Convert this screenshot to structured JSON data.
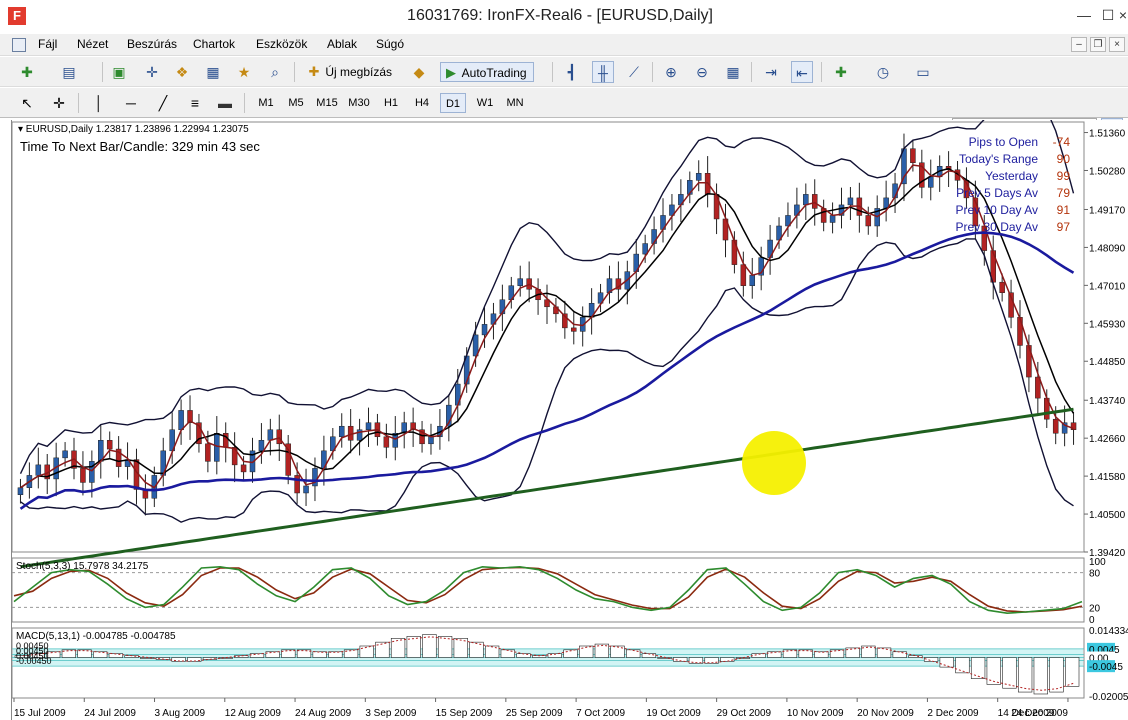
{
  "window": {
    "title": "16031769: IronFX-Real6 - [EURUSD,Daily]",
    "logo": "F",
    "controls": {
      "minimize": "—",
      "maximize": "☐",
      "close": "×"
    }
  },
  "menu": {
    "items": [
      "Fájl",
      "Nézet",
      "Beszúrás",
      "Chartok",
      "Eszközök",
      "Ablak",
      "Súgó"
    ],
    "mdi": {
      "minimize": "–",
      "restore": "❐",
      "close": "×"
    }
  },
  "toolbar": {
    "new_order_label": "Új megbízás",
    "autotrading_label": "AutoTrading",
    "search_placeholder": ""
  },
  "timeframes": [
    "M1",
    "M5",
    "M15",
    "M30",
    "H1",
    "H4",
    "D1",
    "W1",
    "MN"
  ],
  "active_timeframe": "D1",
  "chart_data": {
    "type": "candlestick",
    "symbol_header": "EURUSD,Daily  1.23817 1.23896 1.22994 1.23075",
    "bar_timer": "Time To Next Bar/Candle: 329 min 43 sec",
    "price_axis": [
      "1.51360",
      "1.50280",
      "1.49170",
      "1.48090",
      "1.47010",
      "1.45930",
      "1.44850",
      "1.43740",
      "1.42660",
      "1.41580",
      "1.40500",
      "1.39420"
    ],
    "ylim": [
      1.3942,
      1.5166
    ],
    "date_axis": [
      "15 Jul 2009",
      "24 Jul 2009",
      "3 Aug 2009",
      "12 Aug 2009",
      "24 Aug 2009",
      "3 Sep 2009",
      "15 Sep 2009",
      "25 Sep 2009",
      "7 Oct 2009",
      "19 Oct 2009",
      "29 Oct 2009",
      "10 Nov 2009",
      "20 Nov 2009",
      "2 Dec 2009",
      "14 Dec 2009",
      "24 Dec 2009"
    ],
    "closes": [
      1.4125,
      1.416,
      1.419,
      1.415,
      1.421,
      1.423,
      1.418,
      1.414,
      1.42,
      1.426,
      1.4235,
      1.4185,
      1.4205,
      1.412,
      1.4095,
      1.416,
      1.423,
      1.429,
      1.4345,
      1.431,
      1.425,
      1.42,
      1.428,
      1.424,
      1.419,
      1.417,
      1.423,
      1.426,
      1.429,
      1.425,
      1.416,
      1.411,
      1.413,
      1.418,
      1.423,
      1.427,
      1.43,
      1.426,
      1.429,
      1.431,
      1.427,
      1.424,
      1.428,
      1.431,
      1.429,
      1.425,
      1.427,
      1.43,
      1.436,
      1.442,
      1.45,
      1.456,
      1.459,
      1.462,
      1.466,
      1.47,
      1.472,
      1.469,
      1.466,
      1.464,
      1.462,
      1.458,
      1.457,
      1.461,
      1.465,
      1.468,
      1.472,
      1.469,
      1.474,
      1.479,
      1.482,
      1.486,
      1.49,
      1.493,
      1.496,
      1.5,
      1.502,
      1.496,
      1.489,
      1.483,
      1.476,
      1.47,
      1.473,
      1.478,
      1.483,
      1.487,
      1.49,
      1.493,
      1.496,
      1.492,
      1.488,
      1.49,
      1.493,
      1.495,
      1.49,
      1.487,
      1.492,
      1.495,
      1.499,
      1.509,
      1.505,
      1.498,
      1.501,
      1.504,
      1.503,
      1.5,
      1.495,
      1.487,
      1.48,
      1.471,
      1.468,
      1.461,
      1.453,
      1.444,
      1.438,
      1.432,
      1.428,
      1.431,
      1.429
    ],
    "stochastic": {
      "label": "Stoch(5,3,3) 15.7978 34.2175",
      "levels": [
        "100",
        "80",
        "20",
        "0"
      ],
      "main": [
        30,
        55,
        80,
        85,
        82,
        60,
        35,
        20,
        25,
        55,
        88,
        90,
        85,
        60,
        40,
        30,
        55,
        85,
        88,
        70,
        40,
        25,
        30,
        50,
        80,
        90,
        88,
        90,
        85,
        70,
        50,
        35,
        30,
        20,
        15,
        20,
        50,
        85,
        88,
        60,
        30,
        15,
        20,
        45,
        80,
        85,
        75,
        55,
        70,
        75,
        60,
        30,
        15,
        10,
        12,
        15,
        18,
        30
      ],
      "signal": [
        40,
        48,
        70,
        82,
        84,
        70,
        45,
        28,
        22,
        42,
        75,
        88,
        88,
        72,
        50,
        35,
        45,
        72,
        86,
        78,
        55,
        32,
        28,
        42,
        68,
        85,
        88,
        89,
        87,
        78,
        60,
        42,
        33,
        24,
        18,
        18,
        38,
        72,
        86,
        72,
        45,
        22,
        18,
        35,
        65,
        82,
        80,
        62,
        65,
        72,
        65,
        42,
        22,
        14,
        12,
        14,
        16,
        22
      ]
    },
    "macd": {
      "label": "MACD(5,13,1) -0.004785 -0.004785",
      "axis": [
        "0.014334",
        "0.00",
        "-0.020052"
      ],
      "badges": [
        "0.0045",
        "0.00",
        "-0.0045"
      ],
      "legend_values": [
        "0.00450",
        "0.00450",
        "0.00450",
        "-0.00450"
      ],
      "histogram": [
        0.001,
        0.002,
        0.003,
        0.004,
        0.004,
        0.003,
        0.002,
        0.001,
        0.0,
        -0.001,
        -0.002,
        -0.002,
        -0.001,
        0.0,
        0.001,
        0.002,
        0.003,
        0.004,
        0.004,
        0.003,
        0.003,
        0.004,
        0.006,
        0.008,
        0.01,
        0.011,
        0.012,
        0.011,
        0.01,
        0.008,
        0.006,
        0.004,
        0.002,
        0.001,
        0.002,
        0.004,
        0.006,
        0.007,
        0.006,
        0.004,
        0.002,
        0.0,
        -0.002,
        -0.003,
        -0.003,
        -0.002,
        0.0,
        0.002,
        0.003,
        0.004,
        0.004,
        0.003,
        0.004,
        0.005,
        0.006,
        0.005,
        0.003,
        0.001,
        -0.002,
        -0.005,
        -0.008,
        -0.011,
        -0.014,
        -0.016,
        -0.018,
        -0.019,
        -0.018,
        -0.015
      ]
    },
    "info_panel": [
      {
        "label": "Pips to Open",
        "value": "-74"
      },
      {
        "label": "Today's Range",
        "value": "90"
      },
      {
        "label": "Yesterday",
        "value": "99"
      },
      {
        "label": "Prev 5 Days Av",
        "value": "79"
      },
      {
        "label": "Prev 10 Day Av",
        "value": "91"
      },
      {
        "label": "Prev 30 Day Av",
        "value": "97"
      }
    ],
    "colors": {
      "bull": "#2a5fa8",
      "bear": "#b22222",
      "ma_fast": "#8b1a1a",
      "ma_mid": "#000000",
      "ma_slow": "#1a1a9e",
      "ma_200": "#1f5f1f",
      "stoch_main": "#2e8b2e",
      "stoch_signal": "#8b2a10",
      "macd_hist": "#7fd4d4",
      "cursor": "#f5f000"
    }
  }
}
